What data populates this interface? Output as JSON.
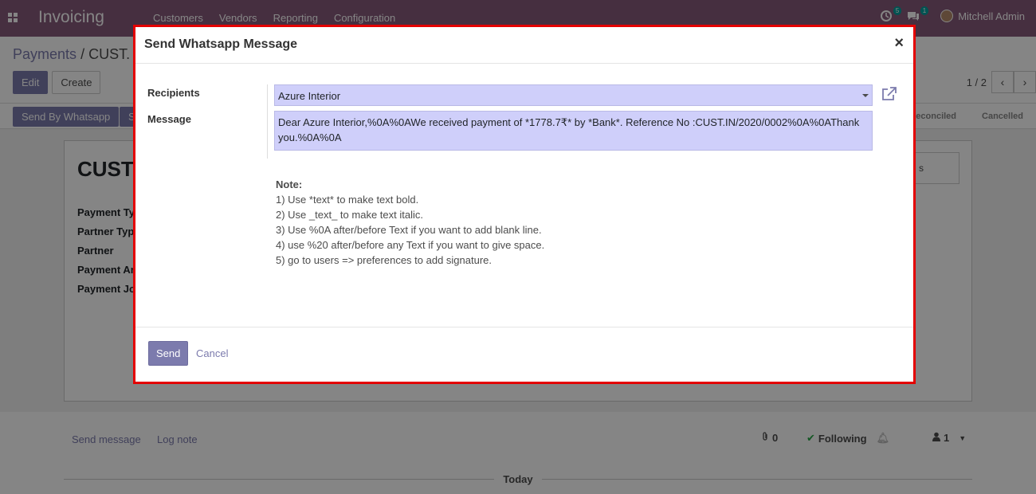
{
  "navbar": {
    "app_title": "Invoicing",
    "menu": [
      "Customers",
      "Vendors",
      "Reporting",
      "Configuration"
    ],
    "activity_count": "5",
    "message_count": "1",
    "user_name": "Mitchell Admin"
  },
  "control_panel": {
    "breadcrumb_root": "Payments",
    "breadcrumb_current": "CUST.",
    "edit_label": "Edit",
    "create_label": "Create",
    "pager_value": "1 / 2"
  },
  "statusbar": {
    "send_whatsapp_label": "Send By Whatsapp",
    "second_button_label": "S",
    "stage_reconciled": "econciled",
    "stage_cancelled": "Cancelled"
  },
  "sheet": {
    "title": "CUST",
    "smart_button_label": "s",
    "labels": [
      "Payment Ty",
      "Partner Typ",
      "Partner",
      "Payment An",
      "Payment Jo"
    ]
  },
  "chatter": {
    "send_message": "Send message",
    "log_note": "Log note",
    "attachments_count": "0",
    "following_label": "Following",
    "followers_count": "1",
    "today_label": "Today"
  },
  "modal": {
    "title": "Send Whatsapp Message",
    "close_symbol": "×",
    "recipients_label": "Recipients",
    "recipients_value": "Azure Interior",
    "message_label": "Message",
    "message_line1": "Dear Azure Interior,%0A%0AWe received payment of *1778.7₹* by  *Bank*. Reference No :CUST.IN/2020/0002%0A%0AThank",
    "message_line2": "you.%0A%0A",
    "note_title": "Note:",
    "note_lines": [
      "1) Use *text* to make text bold.",
      "2) Use _text_ to make text italic.",
      "3) Use %0A after/before Text if you want to add blank line.",
      "4) use %20 after/before any Text if you want to give space.",
      "5) go to users => preferences to add signature."
    ],
    "send_label": "Send",
    "cancel_label": "Cancel"
  },
  "colors": {
    "brand": "#875a7b",
    "primary": "#7c7bad",
    "highlight_border": "#e40000",
    "field_bg": "#cfcffa"
  }
}
